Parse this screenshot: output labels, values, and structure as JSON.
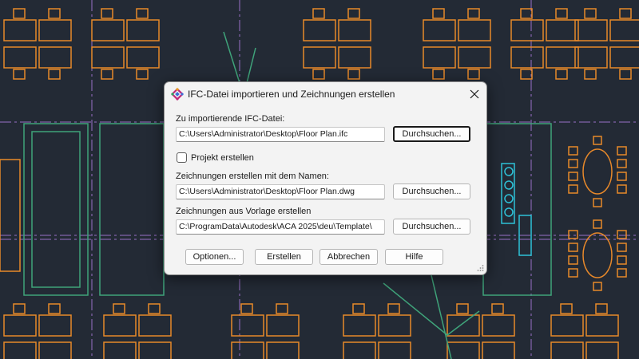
{
  "dialog": {
    "title": "IFC-Datei importieren und Zeichnungen erstellen",
    "close_glyph": "✕"
  },
  "import_file": {
    "label": "Zu importierende IFC-Datei:",
    "value": "C:\\Users\\Administrator\\Desktop\\Floor Plan.ifc",
    "browse_label": "Durchsuchen..."
  },
  "project": {
    "label": "Projekt erstellen",
    "checked": false
  },
  "drawing_name": {
    "label": "Zeichnungen erstellen mit dem Namen:",
    "value": "C:\\Users\\Administrator\\Desktop\\Floor Plan.dwg",
    "browse_label": "Durchsuchen..."
  },
  "template": {
    "label": "Zeichnungen aus Vorlage erstellen",
    "value": "C:\\ProgramData\\Autodesk\\ACA 2025\\deu\\Template\\",
    "browse_label": "Durchsuchen..."
  },
  "footer": {
    "options_label": "Optionen...",
    "create_label": "Erstellen",
    "cancel_label": "Abbrechen",
    "help_label": "Hilfe"
  },
  "colors": {
    "cad_background": "#232a35",
    "cad_orange": "#e8892a",
    "cad_green": "#3fa37a",
    "cad_purple": "#9a70c8",
    "cad_cyan": "#2ec2d8",
    "dialog_background": "#f3f3f3"
  }
}
